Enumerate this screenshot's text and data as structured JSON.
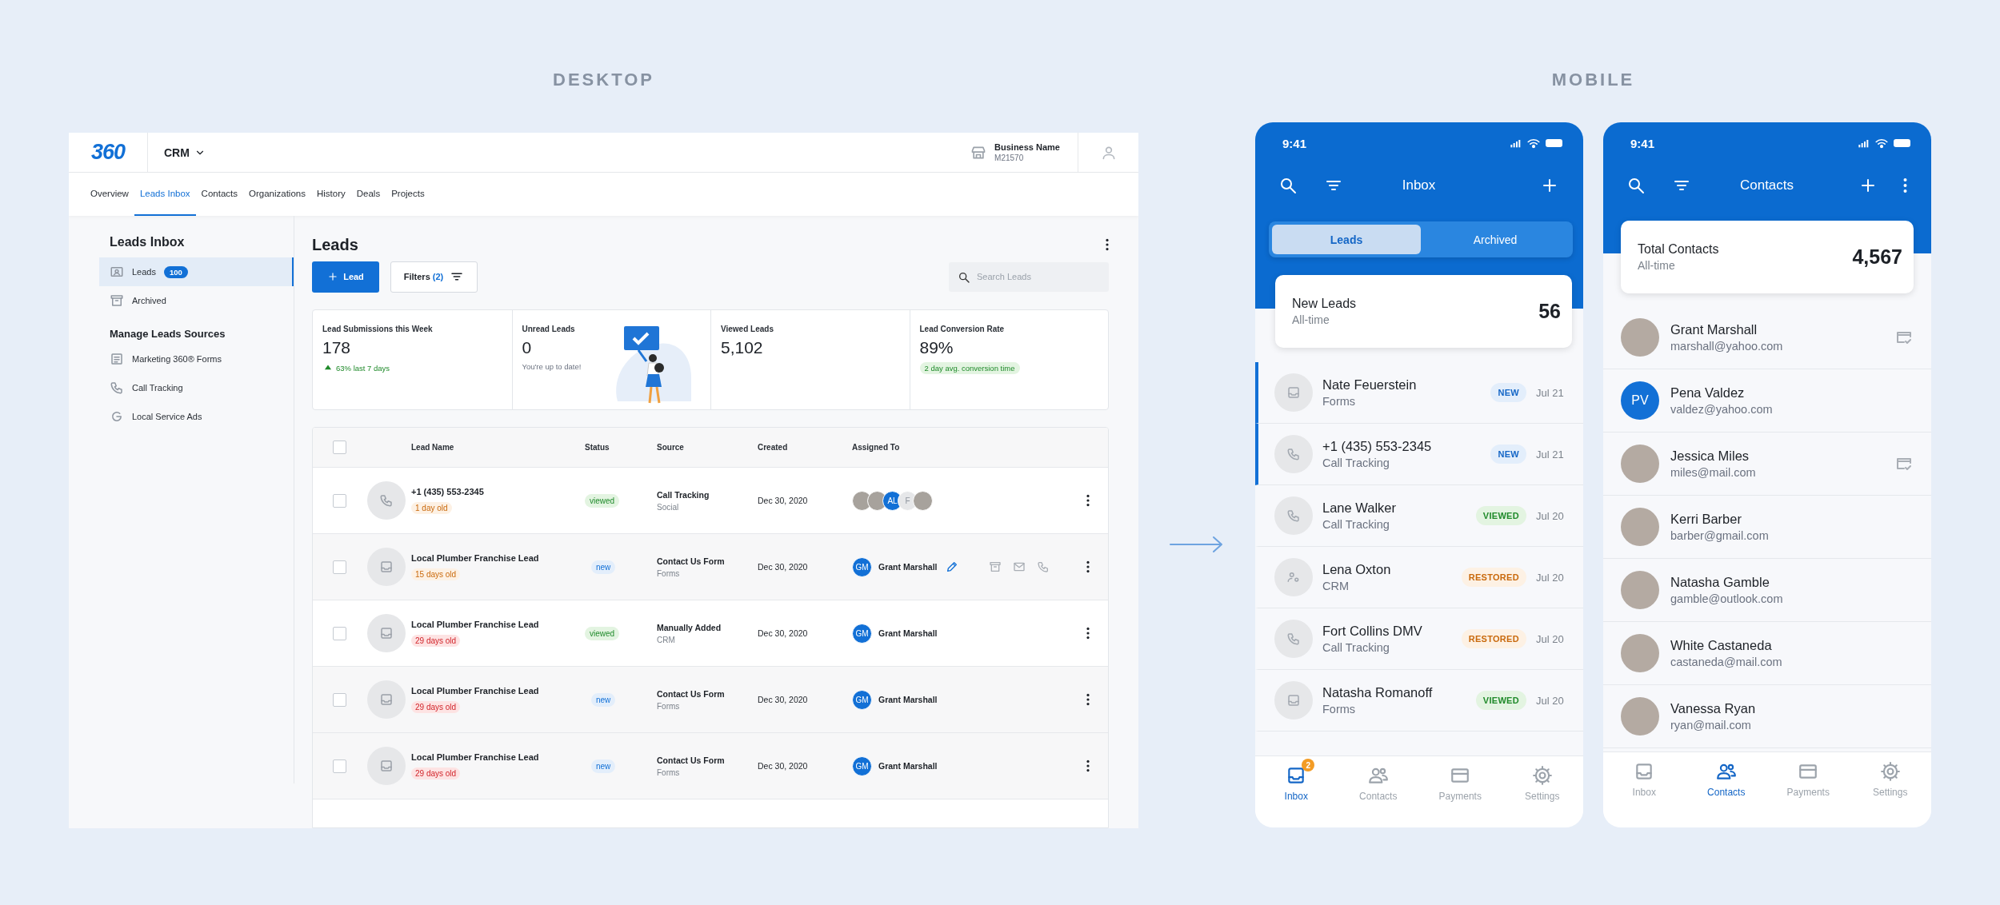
{
  "desktop": {
    "label": "DESKTOP",
    "header": {
      "logo": "360",
      "app": "CRM",
      "business_name": "Business Name",
      "business_id": "M21570"
    },
    "nav": [
      {
        "label": "Overview",
        "selected": false
      },
      {
        "label": "Leads Inbox",
        "selected": true
      },
      {
        "label": "Contacts",
        "selected": false
      },
      {
        "label": "Organizations",
        "selected": false
      },
      {
        "label": "History",
        "selected": false
      },
      {
        "label": "Deals",
        "selected": false
      },
      {
        "label": "Projects",
        "selected": false
      }
    ],
    "sidebar": {
      "title": "Leads Inbox",
      "items": [
        {
          "label": "Leads",
          "count": "100",
          "kind": "leads",
          "selected": true
        },
        {
          "label": "Archived",
          "kind": "archived",
          "selected": false
        }
      ],
      "sources_title": "Manage Leads Sources",
      "sources": [
        {
          "label": "Marketing 360® Forms",
          "kind": "form"
        },
        {
          "label": "Call Tracking",
          "kind": "call"
        },
        {
          "label": "Local Service Ads",
          "kind": "google"
        }
      ]
    },
    "main": {
      "title": "Leads",
      "add_button": "Lead",
      "filters": {
        "label": "Filters",
        "count": "(2)"
      },
      "search": {
        "placeholder": "Search Leads"
      },
      "stats": [
        {
          "kind": "trend",
          "label": "Lead Submissions this Week",
          "value": "178",
          "note": "63% last 7 days"
        },
        {
          "kind": "illustrated",
          "label": "Unread Leads",
          "value": "0",
          "note": "You're up to date!"
        },
        {
          "kind": "basic",
          "label": "Viewed Leads",
          "value": "5,102"
        },
        {
          "kind": "pill",
          "label": "Lead Conversion Rate",
          "value": "89%",
          "note": "2 day avg. conversion time"
        }
      ],
      "table": {
        "select_all": false,
        "columns": [
          "Lead Name",
          "Status",
          "Source",
          "Created",
          "Assigned To"
        ],
        "rows": [
          {
            "kind": "call",
            "checked": false,
            "hovered": false,
            "name": "+1 (435) 553-2345",
            "age": {
              "text": "1 day old",
              "kind": "warning"
            },
            "status": {
              "text": "viewed",
              "kind": "viewed"
            },
            "source": "Call Tracking",
            "source_sub": "Social",
            "created": "Dec 30, 2020",
            "assignees": [
              {
                "kind": "photo"
              },
              {
                "kind": "photo"
              },
              {
                "kind": "initials",
                "initials": "AL"
              },
              {
                "kind": "plain",
                "initials": "F"
              },
              {
                "kind": "photo"
              }
            ]
          },
          {
            "kind": "form",
            "checked": false,
            "hovered": true,
            "name": "Local Plumber Franchise Lead",
            "age": {
              "text": "15 days old",
              "kind": "warning"
            },
            "status": {
              "text": "new",
              "kind": "new"
            },
            "source": "Contact Us Form",
            "source_sub": "Forms",
            "created": "Dec 30, 2020",
            "assignee": {
              "initials": "GM",
              "name": "Grant Marshall"
            }
          },
          {
            "kind": "form",
            "checked": false,
            "hovered": false,
            "name": "Local Plumber Franchise Lead",
            "age": {
              "text": "29 days old",
              "kind": "danger"
            },
            "status": {
              "text": "viewed",
              "kind": "viewed"
            },
            "source": "Manually Added",
            "source_sub": "CRM",
            "created": "Dec 30, 2020",
            "assignee": {
              "initials": "GM",
              "name": "Grant Marshall"
            }
          },
          {
            "kind": "form",
            "checked": false,
            "hovered": false,
            "name": "Local Plumber Franchise Lead",
            "age": {
              "text": "29 days old",
              "kind": "danger"
            },
            "status": {
              "text": "new",
              "kind": "new"
            },
            "source": "Contact Us Form",
            "source_sub": "Forms",
            "created": "Dec 30, 2020",
            "assignee": {
              "initials": "GM",
              "name": "Grant Marshall"
            }
          },
          {
            "kind": "form",
            "checked": false,
            "hovered": false,
            "name": "Local Plumber Franchise Lead",
            "age": {
              "text": "29 days old",
              "kind": "danger"
            },
            "status": {
              "text": "new",
              "kind": "new"
            },
            "source": "Contact Us Form",
            "source_sub": "Forms",
            "created": "Dec 30, 2020",
            "assignee": {
              "initials": "GM",
              "name": "Grant Marshall"
            }
          }
        ]
      }
    }
  },
  "mobile": {
    "label": "MOBILE",
    "screens": [
      {
        "kind": "inbox",
        "time": "9:41",
        "title": "Inbox",
        "segments": [
          {
            "label": "Leads",
            "selected": true
          },
          {
            "label": "Archived",
            "selected": false
          }
        ],
        "summary": {
          "title": "New Leads",
          "sub": "All-time",
          "value": "56"
        },
        "leads": [
          {
            "kind": "form",
            "name": "Nate Feuerstein",
            "source": "Forms",
            "badge": {
              "text": "NEW",
              "kind": "new"
            },
            "date": "Jul 21",
            "unread": true
          },
          {
            "kind": "call",
            "name": "+1 (435) 553-2345",
            "source": "Call Tracking",
            "badge": {
              "text": "NEW",
              "kind": "new"
            },
            "date": "Jul 21",
            "unread": true
          },
          {
            "kind": "call",
            "name": "Lane Walker",
            "source": "Call Tracking",
            "badge": {
              "text": "VIEWED",
              "kind": "viewed"
            },
            "date": "Jul 20",
            "unread": false
          },
          {
            "kind": "crm",
            "name": "Lena Oxton",
            "source": "CRM",
            "badge": {
              "text": "RESTORED",
              "kind": "restored"
            },
            "date": "Jul 20",
            "unread": false
          },
          {
            "kind": "call",
            "name": "Fort Collins DMV",
            "source": "Call Tracking",
            "badge": {
              "text": "RESTORED",
              "kind": "restored"
            },
            "date": "Jul 20",
            "unread": false
          },
          {
            "kind": "form",
            "name": "Natasha Romanoff",
            "source": "Forms",
            "badge": {
              "text": "VIEWED",
              "kind": "viewed"
            },
            "date": "Jul 20",
            "unread": false
          }
        ],
        "nav": [
          {
            "kind": "inbox",
            "label": "Inbox",
            "selected": true,
            "badge": "2"
          },
          {
            "kind": "contacts",
            "label": "Contacts",
            "selected": false
          },
          {
            "kind": "payments",
            "label": "Payments",
            "selected": false
          },
          {
            "kind": "settings",
            "label": "Settings",
            "selected": false
          }
        ]
      },
      {
        "kind": "contacts",
        "time": "9:41",
        "title": "Contacts",
        "summary": {
          "title": "Total Contacts",
          "sub": "All-time",
          "value": "4,567"
        },
        "contacts": [
          {
            "kind": "photo",
            "name": "Grant Marshall",
            "email": "marshall@yahoo.com",
            "has_card": true
          },
          {
            "kind": "initials",
            "initials": "PV",
            "name": "Pena Valdez",
            "email": "valdez@yahoo.com",
            "has_card": false
          },
          {
            "kind": "photo",
            "name": "Jessica Miles",
            "email": "miles@mail.com",
            "has_card": true
          },
          {
            "kind": "photo",
            "name": "Kerri Barber",
            "email": "barber@gmail.com",
            "has_card": false
          },
          {
            "kind": "photo",
            "name": "Natasha Gamble",
            "email": "gamble@outlook.com",
            "has_card": false
          },
          {
            "kind": "photo",
            "name": "White Castaneda",
            "email": "castaneda@mail.com",
            "has_card": false
          },
          {
            "kind": "photo",
            "name": "Vanessa Ryan",
            "email": "ryan@mail.com",
            "has_card": false
          }
        ],
        "nav": [
          {
            "kind": "inbox",
            "label": "Inbox",
            "selected": false
          },
          {
            "kind": "contacts",
            "label": "Contacts",
            "selected": true
          },
          {
            "kind": "payments",
            "label": "Payments",
            "selected": false
          },
          {
            "kind": "settings",
            "label": "Settings",
            "selected": false
          }
        ]
      }
    ]
  }
}
